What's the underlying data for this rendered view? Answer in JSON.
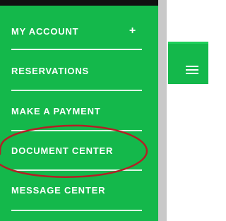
{
  "menu": {
    "items": [
      {
        "label": "MY ACCOUNT",
        "toggle": "+"
      },
      {
        "label": "RESERVATIONS"
      },
      {
        "label": "MAKE A PAYMENT"
      },
      {
        "label": "DOCUMENT CENTER"
      },
      {
        "label": "MESSAGE CENTER"
      }
    ]
  },
  "header": {
    "menu_icon": "hamburger-icon"
  },
  "colors": {
    "menu_green": "#14b84b",
    "annotation_red": "#b31f25",
    "scrollbar_gray": "#c9c9c9"
  }
}
